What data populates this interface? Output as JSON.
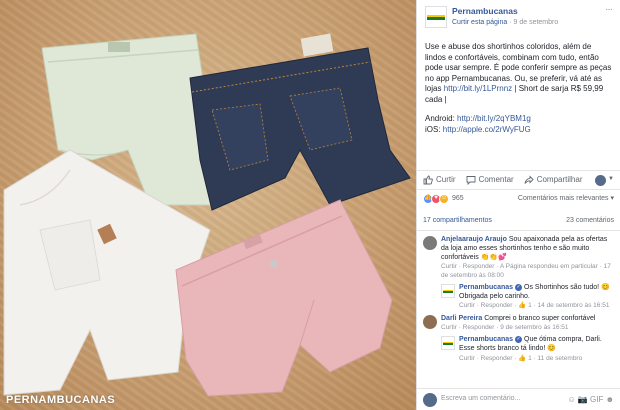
{
  "photo": {
    "watermark": "PERNAMBUCANAS"
  },
  "post": {
    "page_name": "Pernambucanas",
    "like_page": "Curtir esta página",
    "date": "9 de setembro",
    "more": "···",
    "paragraph1": "Use e abuse dos shortinhos coloridos, além de lindos e confortáveis, combinam com tudo, então pode usar sempre. É pode conferir sempre as peças no app Pernambucanas. Ou, se preferir, vá até as lojas",
    "link1": "http://bit.ly/1LPrnnz",
    "paragraph1_end": "| Short de sarja R$ 59,99 cada |",
    "android_label": "Android:",
    "android_link": "http://bit.ly/2qYBM1g",
    "ios_label": "iOS:",
    "ios_link": "http://apple.co/2rWyFUG"
  },
  "actions": {
    "like": "Curtir",
    "comment": "Comentar",
    "share": "Compartilhar"
  },
  "reactions": {
    "count": "965",
    "sort": "Comentários mais relevantes ▾"
  },
  "stats": {
    "shares": "17 compartilhamentos",
    "comments": "23 comentários"
  },
  "comments": [
    {
      "name": "Anjelaaraujo Araujo",
      "text": "Sou apaixonada pela as ofertas da loja amo esses shortinhos tenho e são muito confortáveis 👏👏💕",
      "meta_a": "Curtir · Responder · ",
      "meta_b": "A Página respondeu em particular",
      "meta_c": " · 17 de setembro às 08:00",
      "avatar_color": "#7a7a7a"
    },
    {
      "name": "Pernambucanas",
      "text": "Os Shortinhos são tudo! 😊 Obrigada pelo carinho.",
      "meta": "Curtir · Responder · 👍 1 · 14 de setembro às 16:51"
    },
    {
      "name": "Darli Pereira",
      "text": "Comprei o branco super confortável",
      "meta": "Curtir · Responder · 9 de setembro às 16:51",
      "avatar_color": "#8e6e53"
    },
    {
      "name": "Pernambucanas",
      "text": "Que ótima compra, Darli. Esse shorts branco tá lindo! 😊",
      "meta": "Curtir · Responder · 👍 1 · 11 de setembro"
    }
  ],
  "write": {
    "placeholder": "Escreva um comentário...",
    "icons": "☺ 📷 GIF ☻"
  }
}
